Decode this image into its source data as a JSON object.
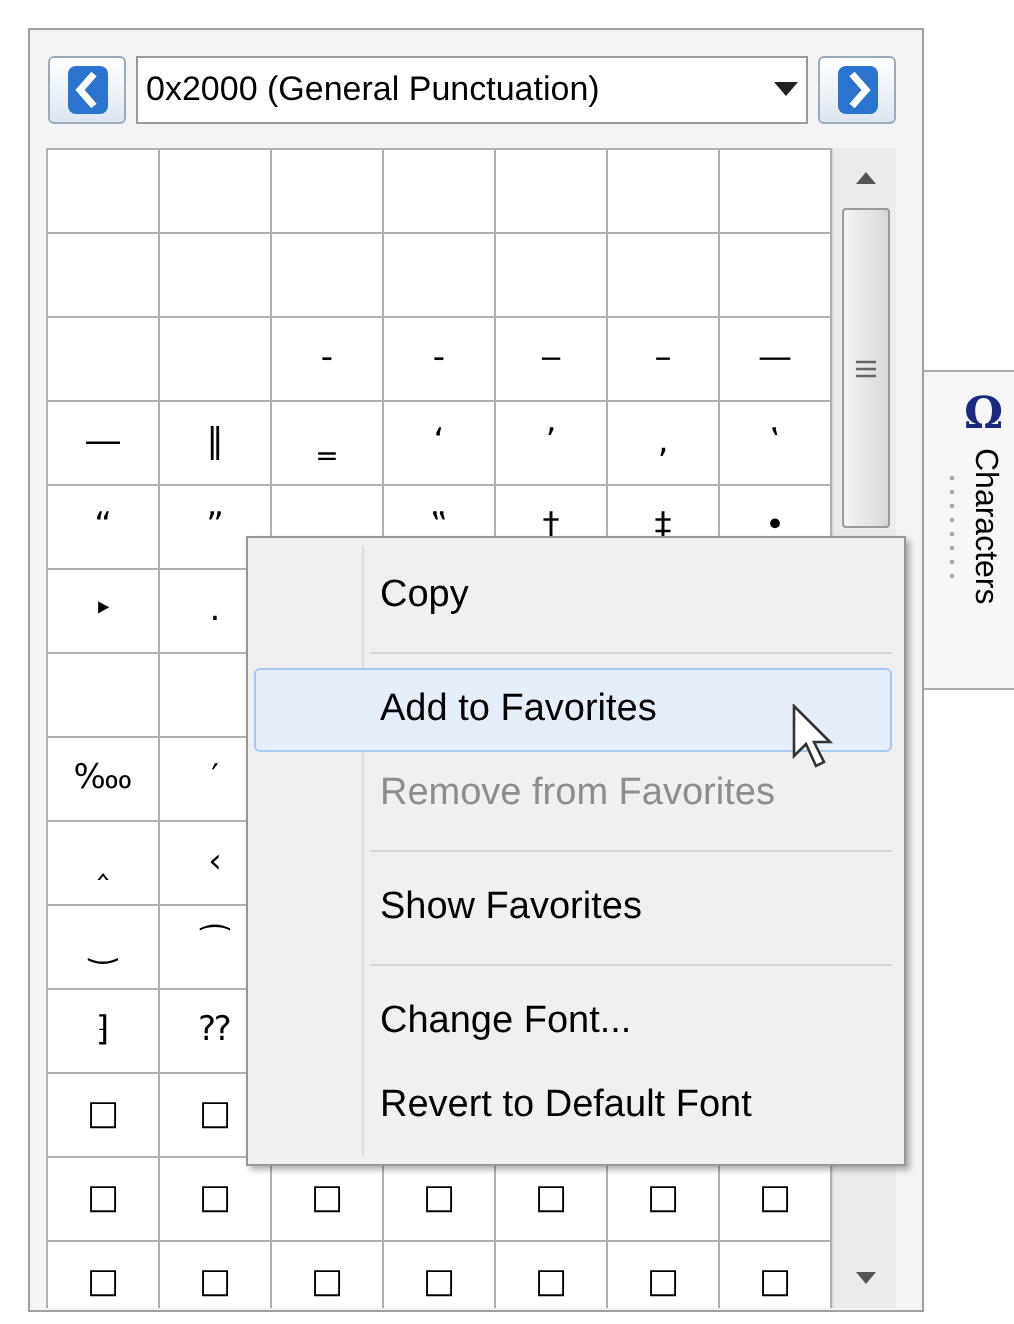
{
  "header": {
    "block_select": {
      "value": "0x2000 (General Punctuation)"
    }
  },
  "grid": {
    "rows": [
      {
        "cells": [
          {},
          {},
          {},
          {},
          {},
          {},
          {}
        ]
      },
      {
        "cells": [
          {},
          {},
          {},
          {},
          {},
          {},
          {}
        ]
      },
      {
        "cells": [
          {},
          {},
          {
            "char": "‐"
          },
          {
            "char": "‑"
          },
          {
            "char": "‒"
          },
          {
            "char": "–"
          },
          {
            "char": "—"
          }
        ]
      },
      {
        "cells": [
          {
            "char": "―"
          },
          {
            "char": "‖"
          },
          {
            "char": "‗"
          },
          {
            "char": "‘"
          },
          {
            "char": "’"
          },
          {
            "char": "‚"
          },
          {
            "char": "‛"
          }
        ]
      },
      {
        "cells": [
          {
            "char": "“"
          },
          {
            "char": "”"
          },
          {},
          {
            "char": "‟"
          },
          {
            "char": "†"
          },
          {
            "char": "‡"
          },
          {
            "char": "•"
          }
        ]
      },
      {
        "cells": [
          {
            "char": "‣"
          },
          {
            "char": "․"
          },
          null,
          null,
          null,
          null,
          null
        ]
      },
      {
        "cells": [
          {},
          {},
          null,
          null,
          null,
          null,
          null
        ]
      },
      {
        "cells": [
          {
            "char": "‱"
          },
          {
            "char": "′"
          },
          null,
          null,
          null,
          null,
          null
        ]
      },
      {
        "cells": [
          {
            "char": "‸"
          },
          {
            "char": "‹"
          },
          null,
          null,
          null,
          null,
          null
        ]
      },
      {
        "cells": [
          {
            "char": "‿"
          },
          {
            "char": "⁀"
          },
          null,
          null,
          null,
          null,
          null
        ]
      },
      {
        "cells": [
          {
            "char": "⁆"
          },
          {
            "char": "⁇"
          },
          null,
          null,
          null,
          null,
          null
        ]
      },
      {
        "cells": [
          {
            "char": "□"
          },
          {
            "char": "□"
          },
          null,
          null,
          null,
          null,
          null
        ]
      },
      {
        "cells": [
          {
            "char": "□"
          },
          {
            "char": "□"
          },
          {
            "char": "□"
          },
          {
            "char": "□"
          },
          {
            "char": "□"
          },
          {
            "char": "□"
          },
          {
            "char": "□"
          }
        ]
      },
      {
        "cells": [
          {
            "char": "□"
          },
          {
            "char": "□"
          },
          {
            "char": "□"
          },
          {
            "char": "□"
          },
          {
            "char": "□"
          },
          {
            "char": "□"
          },
          {
            "char": "□"
          }
        ]
      }
    ]
  },
  "side_tab": {
    "icon": "Ω",
    "label": "Characters"
  },
  "context_menu": {
    "items": [
      {
        "kind": "item",
        "label": "Copy",
        "highlighted": false,
        "disabled": false
      },
      {
        "kind": "separator"
      },
      {
        "kind": "item",
        "label": "Add to Favorites",
        "highlighted": true,
        "disabled": false
      },
      {
        "kind": "item",
        "label": "Remove from Favorites",
        "highlighted": false,
        "disabled": true
      },
      {
        "kind": "separator"
      },
      {
        "kind": "item",
        "label": "Show Favorites",
        "highlighted": false,
        "disabled": false
      },
      {
        "kind": "separator"
      },
      {
        "kind": "item",
        "label": "Change Font...",
        "highlighted": false,
        "disabled": false
      },
      {
        "kind": "item",
        "label": "Revert to Default Font",
        "highlighted": false,
        "disabled": false
      }
    ]
  }
}
